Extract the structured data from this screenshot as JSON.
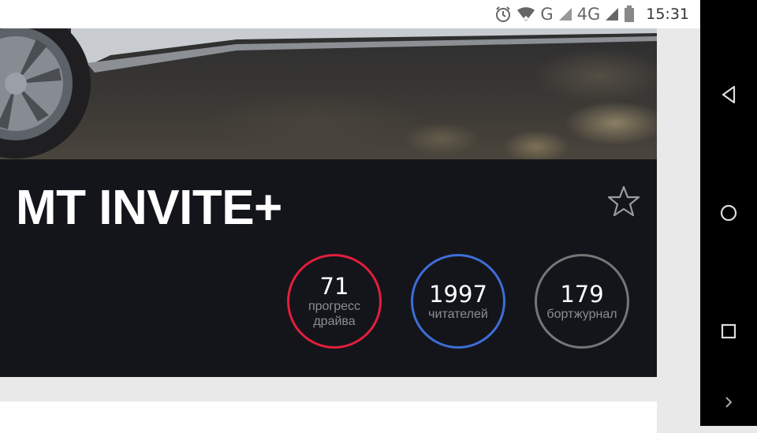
{
  "status_bar": {
    "time": "15:31",
    "network_g": "G",
    "network_4g": "4G",
    "icons": [
      "alarm-icon",
      "wifi-icon",
      "signal-icon",
      "signal-icon",
      "battery-icon"
    ]
  },
  "header": {
    "title": "MT INVITE+",
    "star_icon": "star-outline-icon"
  },
  "stats": [
    {
      "value": "71",
      "label_line1": "прогресс",
      "label_line2": "драйва",
      "color": "#e31e3c"
    },
    {
      "value": "1997",
      "label_line1": "читателей",
      "label_line2": "",
      "color": "#3e6ed6"
    },
    {
      "value": "179",
      "label_line1": "бортжурнал",
      "label_line2": "",
      "color": "#767676"
    }
  ],
  "nav_bar": {
    "icons": [
      "back-icon",
      "home-icon",
      "recents-icon",
      "chevron-right-icon"
    ]
  }
}
